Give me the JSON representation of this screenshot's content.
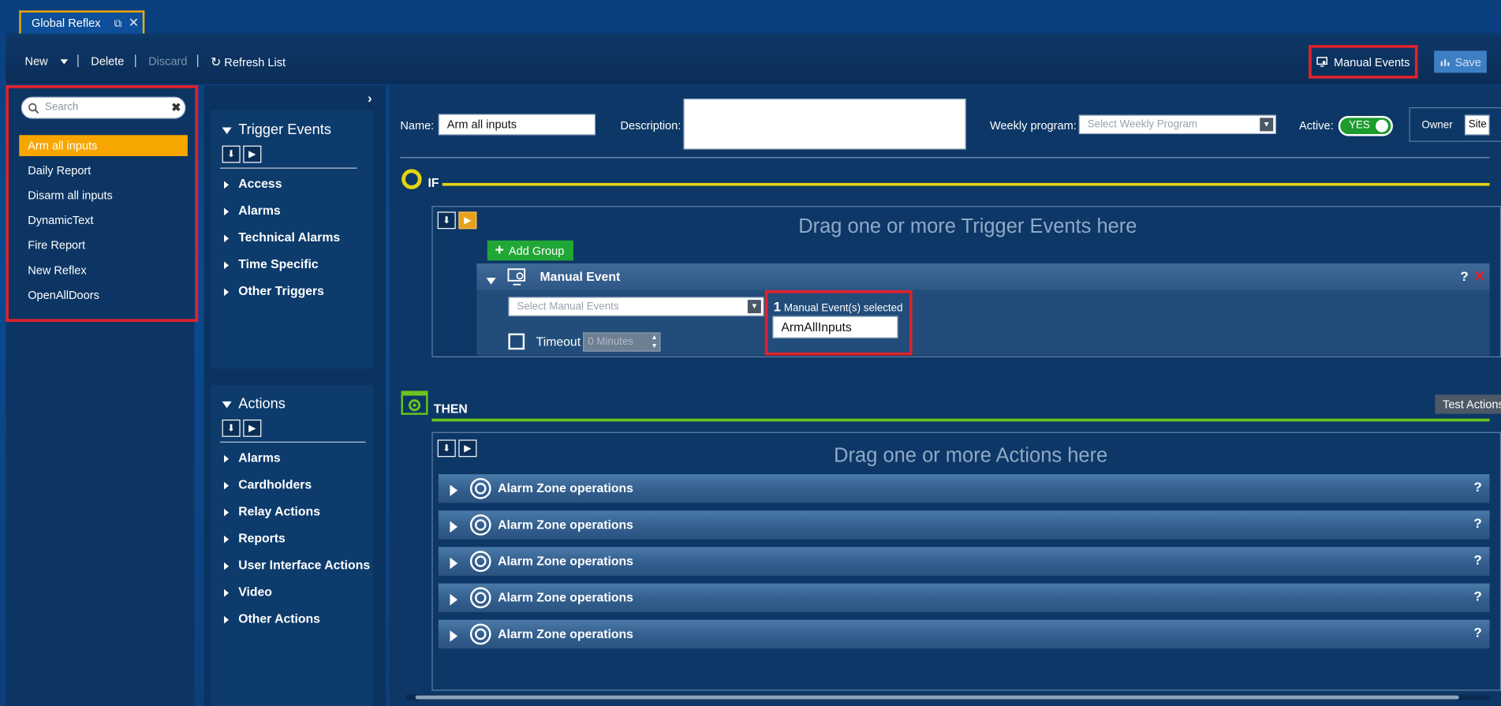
{
  "tab": {
    "title": "Global Reflex"
  },
  "toolbar": {
    "new_label": "New",
    "delete_label": "Delete",
    "discard_label": "Discard",
    "refresh_label": "Refresh List",
    "manual_events_label": "Manual Events",
    "save_label": "Save"
  },
  "sidebar": {
    "search_placeholder": "Search",
    "items": [
      {
        "label": "Arm all inputs",
        "selected": true
      },
      {
        "label": "Daily Report"
      },
      {
        "label": "Disarm all inputs"
      },
      {
        "label": "DynamicText"
      },
      {
        "label": "Fire Report"
      },
      {
        "label": "New Reflex"
      },
      {
        "label": "OpenAllDoors"
      }
    ]
  },
  "triggers": {
    "title": "Trigger Events",
    "items": [
      "Access",
      "Alarms",
      "Technical Alarms",
      "Time Specific",
      "Other Triggers"
    ]
  },
  "actions": {
    "title": "Actions",
    "items": [
      "Alarms",
      "Cardholders",
      "Relay Actions",
      "Reports",
      "User Interface Actions",
      "Video",
      "Other Actions"
    ]
  },
  "form": {
    "name_label": "Name:",
    "name_value": "Arm all inputs",
    "description_label": "Description:",
    "description_value": "",
    "weekly_label": "Weekly program:",
    "weekly_placeholder": "Select Weekly Program",
    "active_label": "Active:",
    "active_value": "YES",
    "owner_label": "Owner",
    "owner_value": "Site"
  },
  "if_section": {
    "label": "IF",
    "drop_text": "Drag one or more Trigger Events here",
    "add_group_label": "Add Group",
    "manual_event": {
      "title": "Manual Event",
      "select_placeholder": "Select Manual Events",
      "selected_count": "1",
      "selected_text": "Manual Event(s) selected",
      "selected_item": "ArmAllInputs",
      "timeout_label": "Timeout",
      "timeout_value": "0 Minutes"
    }
  },
  "then_section": {
    "label": "THEN",
    "drop_text": "Drag one or more Actions here",
    "test_label": "Test Actions",
    "action_rows": [
      "Alarm Zone operations",
      "Alarm Zone operations",
      "Alarm Zone operations",
      "Alarm Zone operations",
      "Alarm Zone operations"
    ]
  },
  "colors": {
    "accent_orange": "#f7a600",
    "highlight_red": "#e0222c",
    "if_yellow": "#e4d410",
    "then_green": "#6cc421",
    "add_green": "#21a735",
    "toggle_green": "#1c9b2e"
  },
  "icons": [
    "popout-icon",
    "close-icon",
    "refresh-icon",
    "monitor-icon",
    "save-icon",
    "search-icon",
    "clear-icon",
    "collapse-arrow-icon",
    "expand-all-icon",
    "collapse-all-icon",
    "ring-icon",
    "gear-window-icon",
    "plus-icon",
    "help-icon",
    "delete-icon"
  ]
}
